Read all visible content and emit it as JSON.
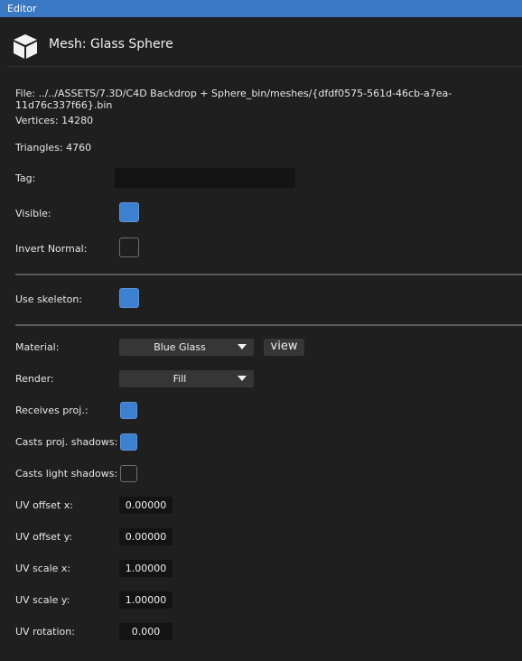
{
  "window": {
    "title": "Editor"
  },
  "mesh": {
    "title": "Mesh: Glass Sphere",
    "icon": "cube-icon",
    "file": "File: ../../ASSETS/7.3D/C4D Backdrop + Sphere_bin/meshes/{dfdf0575-561d-46cb-a7ea-11d76c337f66}.bin",
    "vertices": "Vertices: 14280",
    "triangles": "Triangles: 4760"
  },
  "props": {
    "tag": {
      "label": "Tag:",
      "value": ""
    },
    "visible": {
      "label": "Visible:",
      "checked": true
    },
    "invert_normal": {
      "label": "Invert Normal:",
      "checked": false
    },
    "use_skeleton": {
      "label": "Use skeleton:",
      "checked": true
    },
    "material": {
      "label": "Material:",
      "value": "Blue Glass",
      "view_label": "view"
    },
    "render": {
      "label": "Render:",
      "value": "Fill"
    },
    "receives_proj": {
      "label": "Receives proj.:",
      "checked": true
    },
    "casts_proj_shadows": {
      "label": "Casts proj. shadows:",
      "checked": true
    },
    "casts_light_shadows": {
      "label": "Casts light shadows:",
      "checked": false
    },
    "uv_offset_x": {
      "label": "UV offset x:",
      "value": "0.00000"
    },
    "uv_offset_y": {
      "label": "UV offset y:",
      "value": "0.00000"
    },
    "uv_scale_x": {
      "label": "UV scale x:",
      "value": "1.00000"
    },
    "uv_scale_y": {
      "label": "UV scale y:",
      "value": "1.00000"
    },
    "uv_rotation": {
      "label": "UV rotation:",
      "value": "0.000"
    }
  },
  "colors": {
    "accent": "#3a78c6",
    "checked": "#3d7fd1",
    "background": "#1f1f1f"
  }
}
